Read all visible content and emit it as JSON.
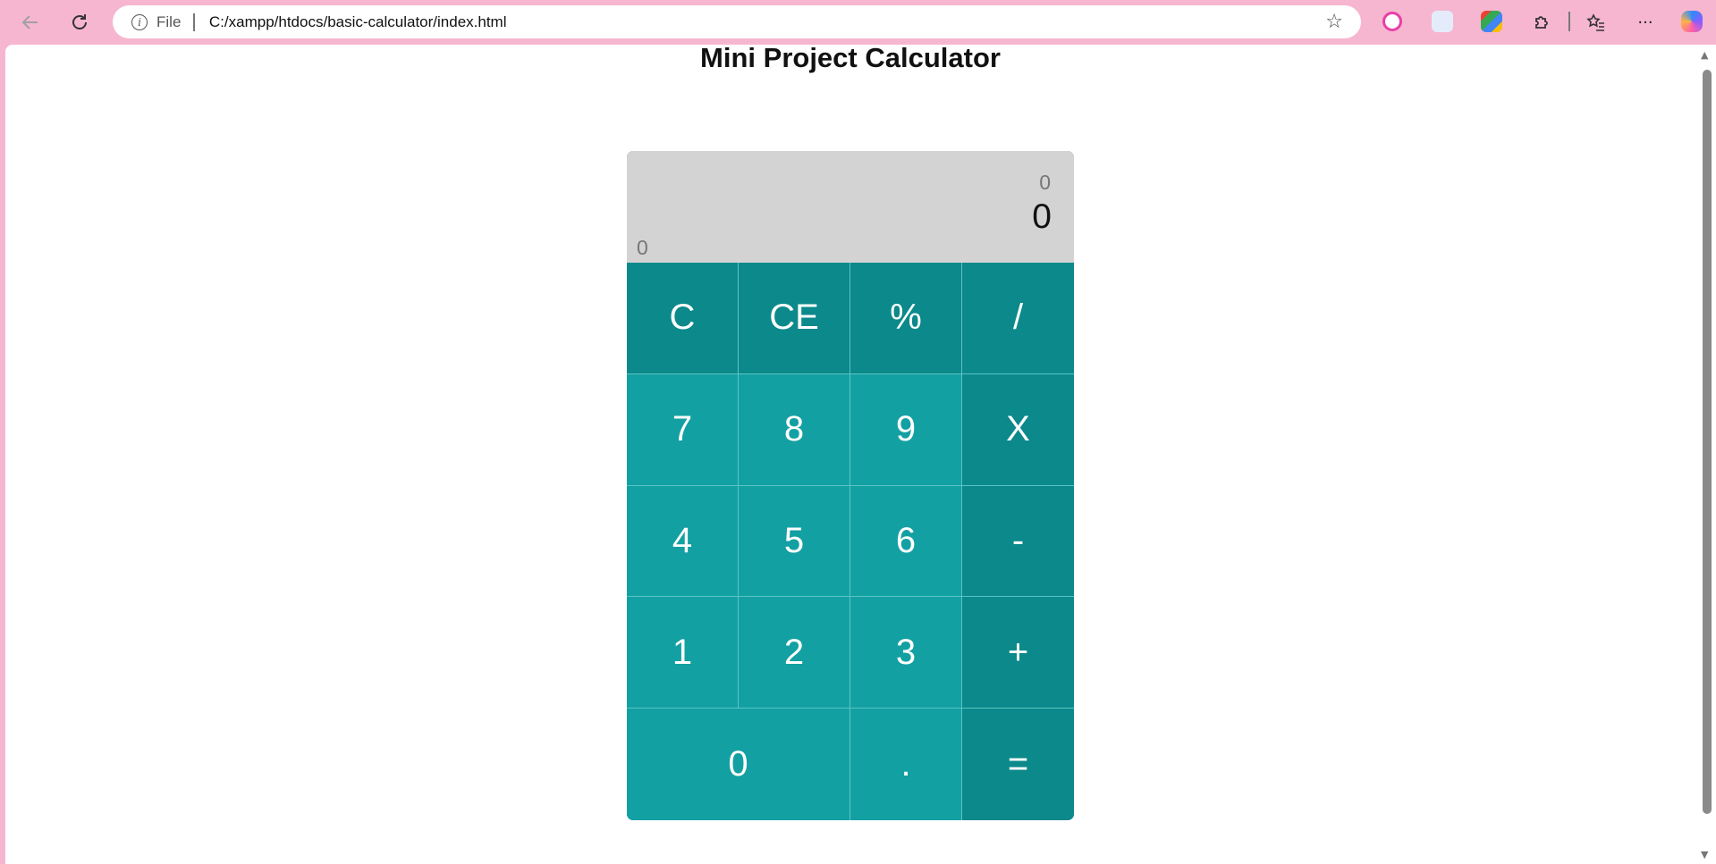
{
  "browser": {
    "file_label": "File",
    "url": "C:/xampp/htdocs/basic-calculator/index.html",
    "more_label": "···"
  },
  "page": {
    "title": "Mini Project Calculator"
  },
  "calculator": {
    "display": {
      "previous": "0",
      "current": "0",
      "history": "0"
    },
    "keys": {
      "clear": "C",
      "clear_entry": "CE",
      "percent": "%",
      "divide": "/",
      "seven": "7",
      "eight": "8",
      "nine": "9",
      "multiply": "X",
      "four": "4",
      "five": "5",
      "six": "6",
      "subtract": "-",
      "one": "1",
      "two": "2",
      "three": "3",
      "add": "+",
      "zero": "0",
      "decimal": ".",
      "equals": "="
    }
  },
  "colors": {
    "browser_frame": "#f7b6cf",
    "display_bg": "#d3d3d3",
    "key_light": "#13a0a3",
    "key_dark": "#0b898b"
  }
}
